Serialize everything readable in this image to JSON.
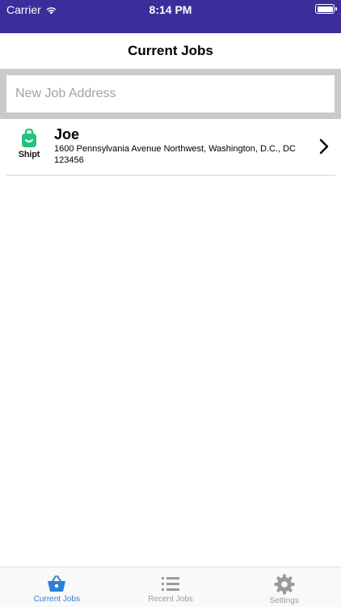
{
  "status_bar": {
    "carrier": "Carrier",
    "time": "8:14 PM"
  },
  "nav": {
    "title": "Current Jobs"
  },
  "search": {
    "placeholder": "New Job Address"
  },
  "jobs": [
    {
      "logo_text": "Shipt",
      "name": "Joe",
      "address": "1600 Pennsylvania Avenue Northwest, Washington, D.C., DC",
      "number": "123456"
    }
  ],
  "tab_bar": {
    "tabs": [
      {
        "label": "Current Jobs",
        "icon": "basket-icon",
        "active": true
      },
      {
        "label": "Recent Jobs",
        "icon": "list-icon",
        "active": false
      },
      {
        "label": "Settings",
        "icon": "gear-icon",
        "active": false
      }
    ]
  },
  "colors": {
    "status_bar_bg": "#3a2e9a",
    "active_tab": "#2f7fd6",
    "shipt_green": "#1fc47a"
  }
}
